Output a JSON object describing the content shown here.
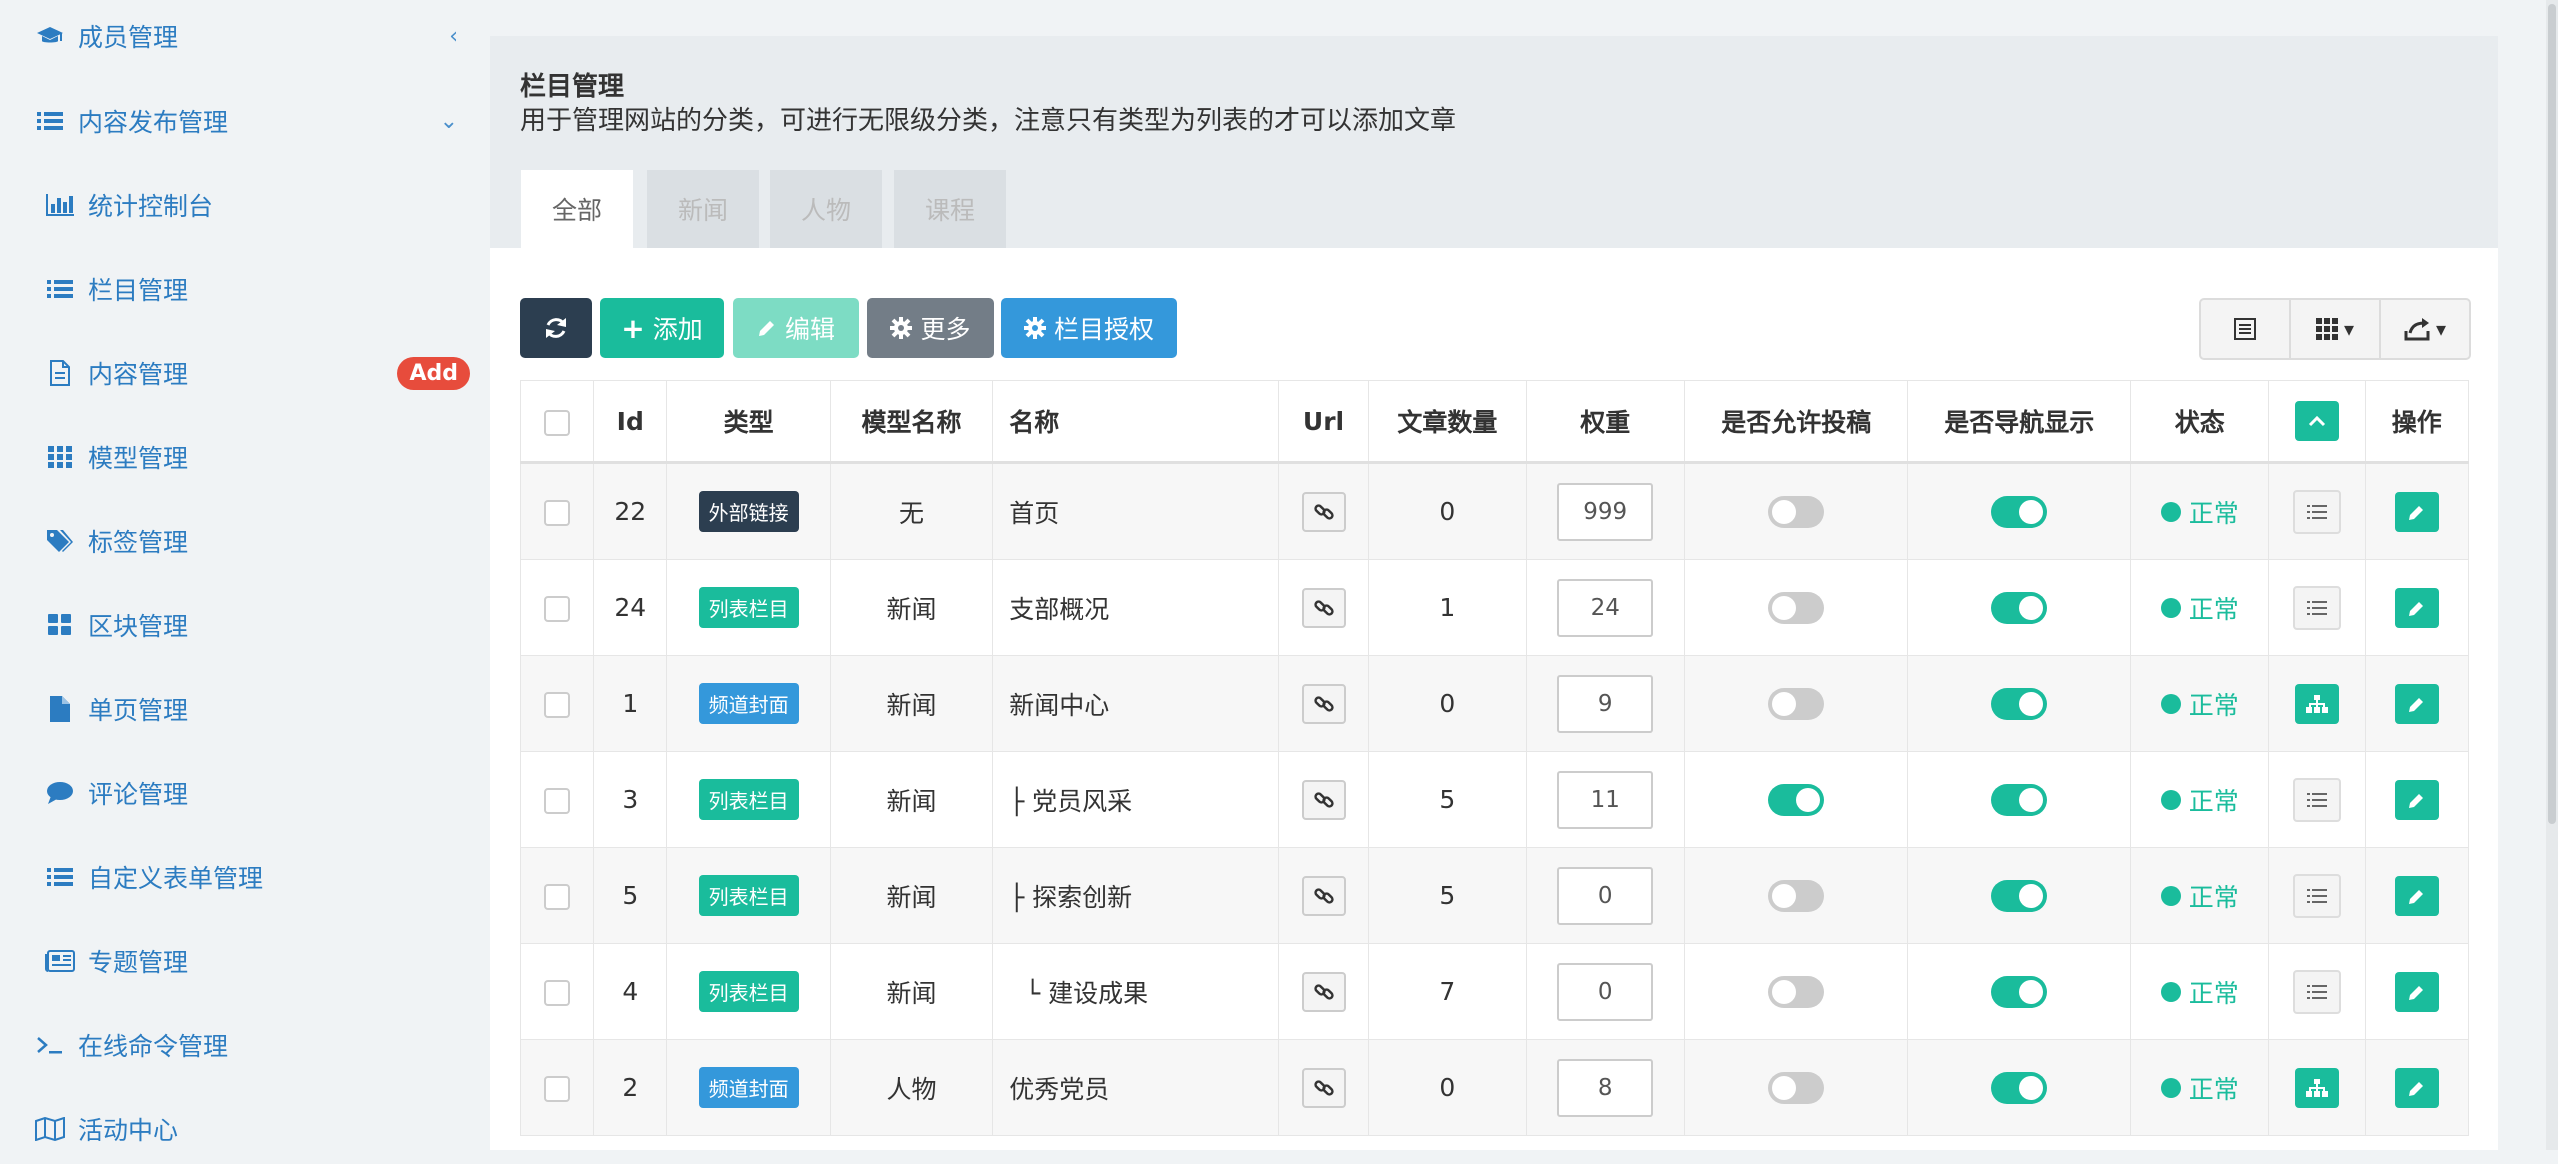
{
  "sidebar": {
    "items": [
      {
        "label": "成员管理",
        "icon": "graduation-cap-icon",
        "arrow": "‹",
        "level": "top"
      },
      {
        "label": "内容发布管理",
        "icon": "list-icon",
        "arrow": "⌄",
        "level": "top"
      },
      {
        "label": "统计控制台",
        "icon": "bar-chart-icon",
        "level": "sub"
      },
      {
        "label": "栏目管理",
        "icon": "list-icon",
        "level": "sub"
      },
      {
        "label": "内容管理",
        "icon": "file-icon",
        "badge": "Add",
        "level": "sub"
      },
      {
        "label": "模型管理",
        "icon": "th-icon",
        "level": "sub"
      },
      {
        "label": "标签管理",
        "icon": "tags-icon",
        "level": "sub"
      },
      {
        "label": "区块管理",
        "icon": "th-large-icon",
        "level": "sub"
      },
      {
        "label": "单页管理",
        "icon": "file-solid-icon",
        "level": "sub"
      },
      {
        "label": "评论管理",
        "icon": "comment-icon",
        "level": "sub"
      },
      {
        "label": "自定义表单管理",
        "icon": "list-icon",
        "level": "sub"
      },
      {
        "label": "专题管理",
        "icon": "newspaper-icon",
        "level": "sub"
      },
      {
        "label": "在线命令管理",
        "icon": "terminal-icon",
        "level": "top"
      },
      {
        "label": "活动中心",
        "icon": "map-icon",
        "level": "top"
      }
    ]
  },
  "header": {
    "title": "栏目管理",
    "description": "用于管理网站的分类，可进行无限级分类，注意只有类型为列表的才可以添加文章"
  },
  "tabs": [
    "全部",
    "新闻",
    "人物",
    "课程"
  ],
  "toolbar": {
    "refresh_icon": "refresh-icon",
    "add": "添加",
    "edit": "编辑",
    "more": "更多",
    "auth": "栏目授权"
  },
  "table": {
    "headers": {
      "id": "Id",
      "type": "类型",
      "model": "模型名称",
      "name": "名称",
      "url": "Url",
      "count": "文章数量",
      "weight": "权重",
      "submit": "是否允许投稿",
      "nav": "是否导航显示",
      "status": "状态",
      "op": "操作"
    },
    "rows": [
      {
        "id": "22",
        "type": "外部链接",
        "type_color": "#2c3e50",
        "model": "无",
        "name": "首页",
        "count": "0",
        "weight": "999",
        "submit": false,
        "nav": true,
        "status": "正常",
        "tree_btn": "list"
      },
      {
        "id": "24",
        "type": "列表栏目",
        "type_color": "#1abc9c",
        "model": "新闻",
        "name": "支部概况",
        "count": "1",
        "weight": "24",
        "submit": false,
        "nav": true,
        "status": "正常",
        "tree_btn": "list"
      },
      {
        "id": "1",
        "type": "频道封面",
        "type_color": "#3498db",
        "model": "新闻",
        "name": "新闻中心",
        "count": "0",
        "weight": "9",
        "submit": false,
        "nav": true,
        "status": "正常",
        "tree_btn": "sitemap"
      },
      {
        "id": "3",
        "type": "列表栏目",
        "type_color": "#1abc9c",
        "model": "新闻",
        "name": "├ 党员风采",
        "count": "5",
        "weight": "11",
        "submit": true,
        "nav": true,
        "status": "正常",
        "tree_btn": "list"
      },
      {
        "id": "5",
        "type": "列表栏目",
        "type_color": "#1abc9c",
        "model": "新闻",
        "name": "├ 探索创新",
        "count": "5",
        "weight": "0",
        "submit": false,
        "nav": true,
        "status": "正常",
        "tree_btn": "list"
      },
      {
        "id": "4",
        "type": "列表栏目",
        "type_color": "#1abc9c",
        "model": "新闻",
        "name": "  └ 建设成果",
        "count": "7",
        "weight": "0",
        "submit": false,
        "nav": true,
        "status": "正常",
        "tree_btn": "list"
      },
      {
        "id": "2",
        "type": "频道封面",
        "type_color": "#3498db",
        "model": "人物",
        "name": "优秀党员",
        "count": "0",
        "weight": "8",
        "submit": false,
        "nav": true,
        "status": "正常",
        "tree_btn": "sitemap"
      }
    ]
  },
  "colors": {
    "accent": "#1abc9c",
    "primary": "#3498db",
    "dark": "#2c3e50",
    "danger": "#e74c3c"
  }
}
